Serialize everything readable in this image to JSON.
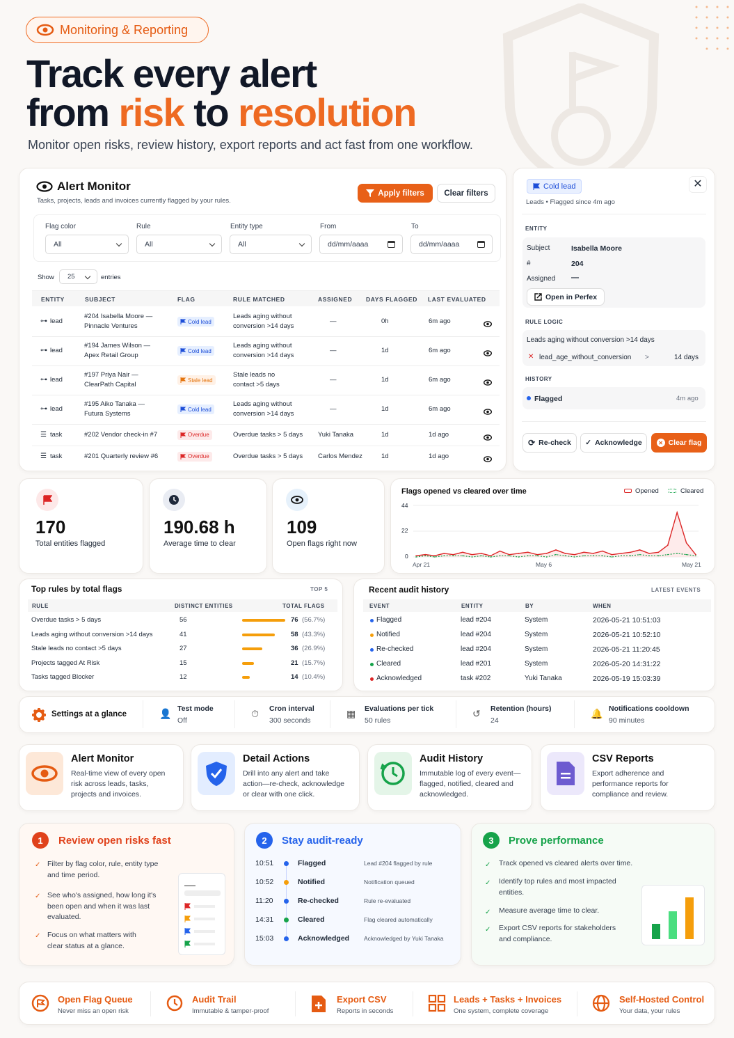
{
  "badge": "Monitoring & Reporting",
  "hero": {
    "line1": "Track every alert",
    "from": "from ",
    "risk": "risk",
    "to": " to ",
    "resolution": "resolution",
    "subtitle": "Monitor open risks, review history, export reports and act fast from one workflow."
  },
  "monitor": {
    "title": "Alert Monitor",
    "subtitle": "Tasks, projects, leads and invoices currently flagged by your rules.",
    "apply": "Apply filters",
    "clear": "Clear filters",
    "filters": {
      "flag_color": "Flag color",
      "rule": "Rule",
      "entity_type": "Entity type",
      "from": "From",
      "to": "To",
      "all": "All",
      "date_ph": "dd/mm/aaaa"
    },
    "show": "Show",
    "show_val": "25",
    "entries": "entries",
    "columns": [
      "ENTITY",
      "SUBJECT",
      "FLAG",
      "RULE MATCHED",
      "ASSIGNED",
      "DAYS FLAGGED",
      "LAST EVALUATED"
    ],
    "rows": [
      {
        "entity": "lead",
        "subject1": "#204 Isabella Moore —",
        "subject2": "Pinnacle Ventures",
        "flag": "Cold lead",
        "rule1": "Leads aging without",
        "rule2": "conversion >14 days",
        "assigned": "—",
        "days": "0h",
        "last": "6m ago"
      },
      {
        "entity": "lead",
        "subject1": "#194 James Wilson —",
        "subject2": "Apex Retail Group",
        "flag": "Cold lead",
        "rule1": "Leads aging without",
        "rule2": "conversion >14 days",
        "assigned": "—",
        "days": "1d",
        "last": "6m ago"
      },
      {
        "entity": "lead",
        "subject1": "#197 Priya Nair —",
        "subject2": "ClearPath Capital",
        "flag": "Stale lead",
        "rule1": "Stale leads no",
        "rule2": "contact >5 days",
        "assigned": "—",
        "days": "1d",
        "last": "6m ago"
      },
      {
        "entity": "lead",
        "subject1": "#195 Aiko Tanaka —",
        "subject2": "Futura Systems",
        "flag": "Cold lead",
        "rule1": "Leads aging without",
        "rule2": "conversion >14 days",
        "assigned": "—",
        "days": "1d",
        "last": "6m ago"
      },
      {
        "entity": "task",
        "subject1": "#202 Vendor check-in #7",
        "subject2": "",
        "flag": "Overdue",
        "rule1": "Overdue tasks > 5 days",
        "rule2": "",
        "assigned": "Yuki Tanaka",
        "days": "1d",
        "last": "1d ago"
      },
      {
        "entity": "task",
        "subject1": "#201 Quarterly review #6",
        "subject2": "",
        "flag": "Overdue",
        "rule1": "Overdue tasks > 5 days",
        "rule2": "",
        "assigned": "Carlos Mendez",
        "days": "1d",
        "last": "1d ago"
      }
    ]
  },
  "detail": {
    "flag": "Cold lead",
    "meta": "Leads • Flagged since 4m ago",
    "entity_h": "ENTITY",
    "subject_l": "Subject",
    "subject_v": "Isabella Moore",
    "num_l": "#",
    "num_v": "204",
    "assigned_l": "Assigned",
    "assigned_v": "—",
    "open": "Open in Perfex",
    "logic_h": "RULE LOGIC",
    "logic_title": "Leads aging without conversion >14 days",
    "logic_key": "lead_age_without_conversion",
    "logic_op": ">",
    "logic_val": "14 days",
    "history_h": "HISTORY",
    "hist_event": "Flagged",
    "hist_time": "4m ago",
    "recheck": "Re-check",
    "ack": "Acknowledge",
    "clearflag": "Clear flag"
  },
  "stats": [
    {
      "value": "170",
      "label": "Total entities flagged"
    },
    {
      "value": "190.68 h",
      "label": "Average time to clear"
    },
    {
      "value": "109",
      "label": "Open flags right now"
    }
  ],
  "chart_data": {
    "type": "line",
    "title": "Flags opened vs cleared over time",
    "legend": [
      "Opened",
      "Cleared"
    ],
    "yticks": [
      "44",
      "22",
      "0"
    ],
    "xticks": [
      "Apr 21",
      "May 6",
      "May 21"
    ],
    "ylim": [
      0,
      44
    ],
    "x": [
      "Apr 21",
      "Apr 22",
      "Apr 23",
      "Apr 24",
      "Apr 25",
      "Apr 26",
      "Apr 27",
      "Apr 28",
      "Apr 29",
      "Apr 30",
      "May 1",
      "May 2",
      "May 3",
      "May 4",
      "May 5",
      "May 6",
      "May 7",
      "May 8",
      "May 9",
      "May 10",
      "May 11",
      "May 12",
      "May 13",
      "May 14",
      "May 15",
      "May 16",
      "May 17",
      "May 18",
      "May 19",
      "May 20",
      "May 21"
    ],
    "series": [
      {
        "name": "Opened",
        "color": "#dc2626",
        "values": [
          1,
          2,
          1,
          3,
          2,
          4,
          2,
          3,
          1,
          5,
          2,
          3,
          4,
          2,
          3,
          6,
          3,
          2,
          4,
          3,
          5,
          2,
          3,
          4,
          6,
          3,
          4,
          10,
          38,
          12,
          2
        ]
      },
      {
        "name": "Cleared",
        "color": "#16a34a",
        "values": [
          0,
          1,
          0,
          1,
          1,
          1,
          0,
          1,
          0,
          1,
          1,
          0,
          1,
          1,
          0,
          2,
          1,
          0,
          1,
          1,
          1,
          0,
          1,
          1,
          2,
          1,
          1,
          2,
          3,
          2,
          1
        ]
      }
    ]
  },
  "toprules": {
    "title": "Top rules by total flags",
    "badge": "TOP 5",
    "cols": [
      "RULE",
      "DISTINCT ENTITIES",
      "TOTAL FLAGS"
    ],
    "rows": [
      {
        "rule": "Overdue tasks > 5 days",
        "distinct": "56",
        "total": "76",
        "pct": "(56.7%)",
        "frac": 0.567
      },
      {
        "rule": "Leads aging without conversion >14 days",
        "distinct": "41",
        "total": "58",
        "pct": "(43.3%)",
        "frac": 0.433
      },
      {
        "rule": "Stale leads no contact >5 days",
        "distinct": "27",
        "total": "36",
        "pct": "(26.9%)",
        "frac": 0.269
      },
      {
        "rule": "Projects tagged At Risk",
        "distinct": "15",
        "total": "21",
        "pct": "(15.7%)",
        "frac": 0.157
      },
      {
        "rule": "Tasks tagged Blocker",
        "distinct": "12",
        "total": "14",
        "pct": "(10.4%)",
        "frac": 0.104
      }
    ]
  },
  "audit": {
    "title": "Recent audit history",
    "badge": "LATEST EVENTS",
    "cols": [
      "EVENT",
      "ENTITY",
      "BY",
      "WHEN"
    ],
    "rows": [
      {
        "event": "Flagged",
        "color": "#2563eb",
        "entity": "lead #204",
        "by": "System",
        "when": "2026-05-21 10:51:03"
      },
      {
        "event": "Notified",
        "color": "#f59e0b",
        "entity": "lead #204",
        "by": "System",
        "when": "2026-05-21 10:52:10"
      },
      {
        "event": "Re-checked",
        "color": "#2563eb",
        "entity": "lead #204",
        "by": "System",
        "when": "2026-05-21 11:20:45"
      },
      {
        "event": "Cleared",
        "color": "#16a34a",
        "entity": "lead #201",
        "by": "System",
        "when": "2026-05-20 14:31:22"
      },
      {
        "event": "Acknowledged",
        "color": "#dc2626",
        "entity": "task #202",
        "by": "Yuki Tanaka",
        "when": "2026-05-19 15:03:39"
      }
    ]
  },
  "settings": {
    "title": "Settings at a glance",
    "items": [
      {
        "k": "Test mode",
        "v": "Off"
      },
      {
        "k": "Cron interval",
        "v": "300 seconds"
      },
      {
        "k": "Evaluations per tick",
        "v": "50 rules"
      },
      {
        "k": "Retention (hours)",
        "v": "24"
      },
      {
        "k": "Notifications cooldown",
        "v": "90 minutes"
      }
    ]
  },
  "features": [
    {
      "title": "Alert Monitor",
      "text": [
        "Real-time view of every open",
        "risk across leads, tasks,",
        "projects and invoices."
      ]
    },
    {
      "title": "Detail Actions",
      "text": [
        "Drill into any alert and take",
        "action—re-check, acknowledge",
        "or clear with one click."
      ]
    },
    {
      "title": "Audit History",
      "text": [
        "Immutable log of every event—",
        "flagged, notified, cleared and",
        "acknowledged."
      ]
    },
    {
      "title": "CSV Reports",
      "text": [
        "Export adherence and",
        "performance reports for",
        "compliance and review."
      ]
    }
  ],
  "steps": {
    "s1": {
      "num": "1",
      "title": "Review open risks fast",
      "b1": [
        "Filter by flag color, rule, entity type",
        "and time period."
      ],
      "b2": [
        "See who's assigned, how long it's",
        "been open and when it was last",
        "evaluated."
      ],
      "b3": [
        "Focus on what matters with",
        "clear status at a glance."
      ]
    },
    "s2": {
      "num": "2",
      "title": "Stay audit-ready",
      "rows": [
        {
          "t": "10:51",
          "e": "Flagged",
          "d": "Lead #204 flagged by rule",
          "c": "#2563eb"
        },
        {
          "t": "10:52",
          "e": "Notified",
          "d": "Notification queued",
          "c": "#f59e0b"
        },
        {
          "t": "11:20",
          "e": "Re-checked",
          "d": "Rule re-evaluated",
          "c": "#2563eb"
        },
        {
          "t": "14:31",
          "e": "Cleared",
          "d": "Flag cleared automatically",
          "c": "#16a34a"
        },
        {
          "t": "15:03",
          "e": "Acknowledged",
          "d": "Acknowledged by Yuki Tanaka",
          "c": "#2563eb"
        }
      ]
    },
    "s3": {
      "num": "3",
      "title": "Prove performance",
      "b1": [
        "Track opened vs cleared alerts over time."
      ],
      "b2": [
        "Identify top rules and most impacted",
        "entities."
      ],
      "b3": [
        "Measure average time to clear."
      ],
      "b4": [
        "Export CSV reports for stakeholders",
        "and compliance."
      ]
    }
  },
  "bottom": [
    {
      "t": "Open Flag Queue",
      "s": "Never miss an open risk"
    },
    {
      "t": "Audit Trail",
      "s": "Immutable & tamper-proof"
    },
    {
      "t": "Export CSV",
      "s": "Reports in seconds"
    },
    {
      "t": "Leads + Tasks + Invoices",
      "s": "One system, complete coverage"
    },
    {
      "t": "Self-Hosted Control",
      "s": "Your data, your rules"
    }
  ]
}
